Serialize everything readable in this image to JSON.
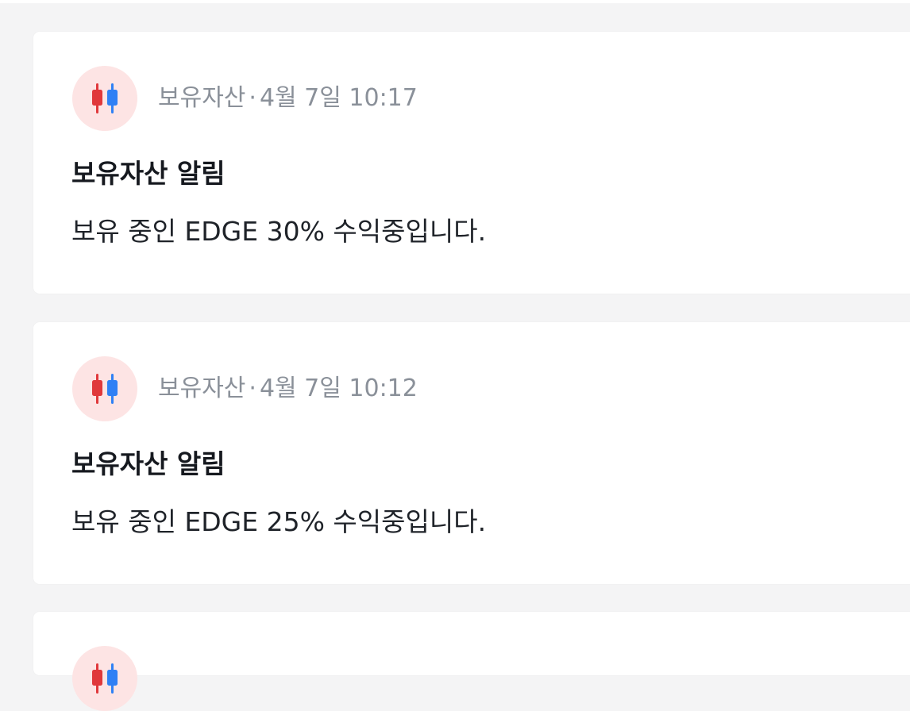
{
  "colors": {
    "page_background": "#f4f4f5",
    "card_background": "#ffffff",
    "icon_background": "#fde4e4",
    "candle_red": "#e0383b",
    "candle_blue": "#2f80f5",
    "meta_text": "#8a9099",
    "title_text": "#16191f"
  },
  "notifications": [
    {
      "icon": "candlestick-chart-icon",
      "category": "보유자산",
      "separator": "·",
      "time": "4월 7일 10:17",
      "title": "보유자산 알림",
      "message": "보유 중인 EDGE 30% 수익중입니다."
    },
    {
      "icon": "candlestick-chart-icon",
      "category": "보유자산",
      "separator": "·",
      "time": "4월 7일 10:12",
      "title": "보유자산 알림",
      "message": "보유 중인 EDGE 25% 수익중입니다."
    },
    {
      "icon": "candlestick-chart-icon"
    }
  ]
}
